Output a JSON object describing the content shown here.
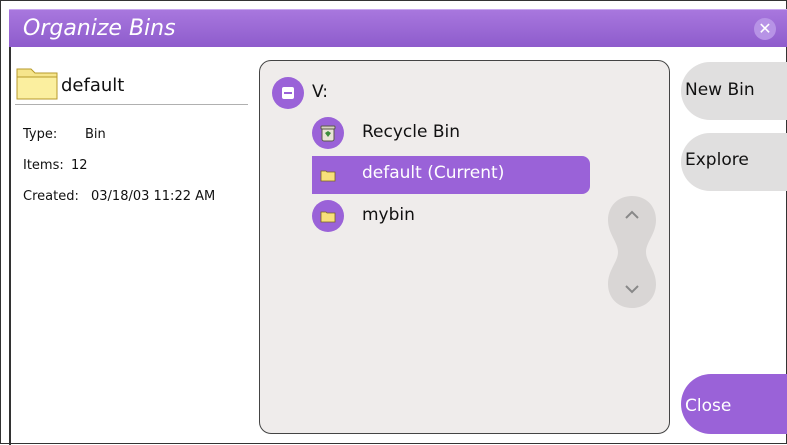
{
  "window": {
    "title": "Organize Bins"
  },
  "details": {
    "name": "default",
    "type_label": "Type:",
    "type_value": "Bin",
    "items_label": "Items:",
    "items_value": "12",
    "created_label": "Created:",
    "created_value": "03/18/03 11:22 AM"
  },
  "tree": {
    "root_label": "V:",
    "items": [
      {
        "label": "Recycle Bin",
        "icon": "recycle-bin-icon"
      },
      {
        "label": "default (Current)",
        "icon": "folder-icon"
      },
      {
        "label": "mybin",
        "icon": "folder-icon"
      }
    ]
  },
  "buttons": {
    "new_bin": "New Bin",
    "explore": "Explore",
    "close": "Close"
  },
  "colors": {
    "accent": "#9a62d8",
    "panel_bg": "#efeceb",
    "button_bg": "#e0dfdf"
  }
}
